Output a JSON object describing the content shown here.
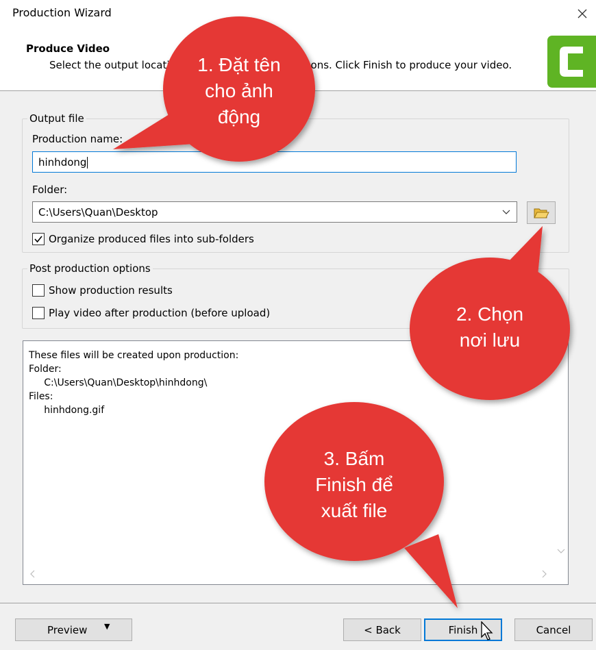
{
  "window": {
    "title": "Production Wizard",
    "close_icon": "close-icon"
  },
  "header": {
    "title": "Produce Video",
    "description": "Select the output locati",
    "description_end": "ons. Click Finish to produce your video.",
    "logo_icon": "camtasia-logo-icon",
    "logo_color": "#5fb424"
  },
  "output_file": {
    "group_label": "Output file",
    "production_name_label": "Production name:",
    "production_name_value": "hinhdong",
    "folder_label": "Folder:",
    "folder_value": "C:\\Users\\Quan\\Desktop",
    "browse_icon": "folder-open-icon",
    "organize_label": "Organize produced files into sub-folders",
    "organize_checked": true
  },
  "post_production": {
    "group_label": "Post production options",
    "show_results_label": "Show production results",
    "show_results_checked": false,
    "play_video_label": "Play video after production (before upload)",
    "play_video_checked": false
  },
  "info_panel": {
    "text": "These files will be created upon production:\nFolder:\n     C:\\Users\\Quan\\Desktop\\hinhdong\\\nFiles:\n     hinhdong.gif"
  },
  "buttons": {
    "preview": "Preview",
    "back": "< Back",
    "finish": "Finish",
    "cancel": "Cancel"
  },
  "callouts": [
    {
      "text": "1. Đặt tên\ncho ảnh\nđộng"
    },
    {
      "text": "2. Chọn\nnơi lưu"
    },
    {
      "text": "3. Bấm\nFinish để\nxuất file"
    }
  ],
  "colors": {
    "callout_red": "#e53935",
    "focus_blue": "#0078d7"
  }
}
